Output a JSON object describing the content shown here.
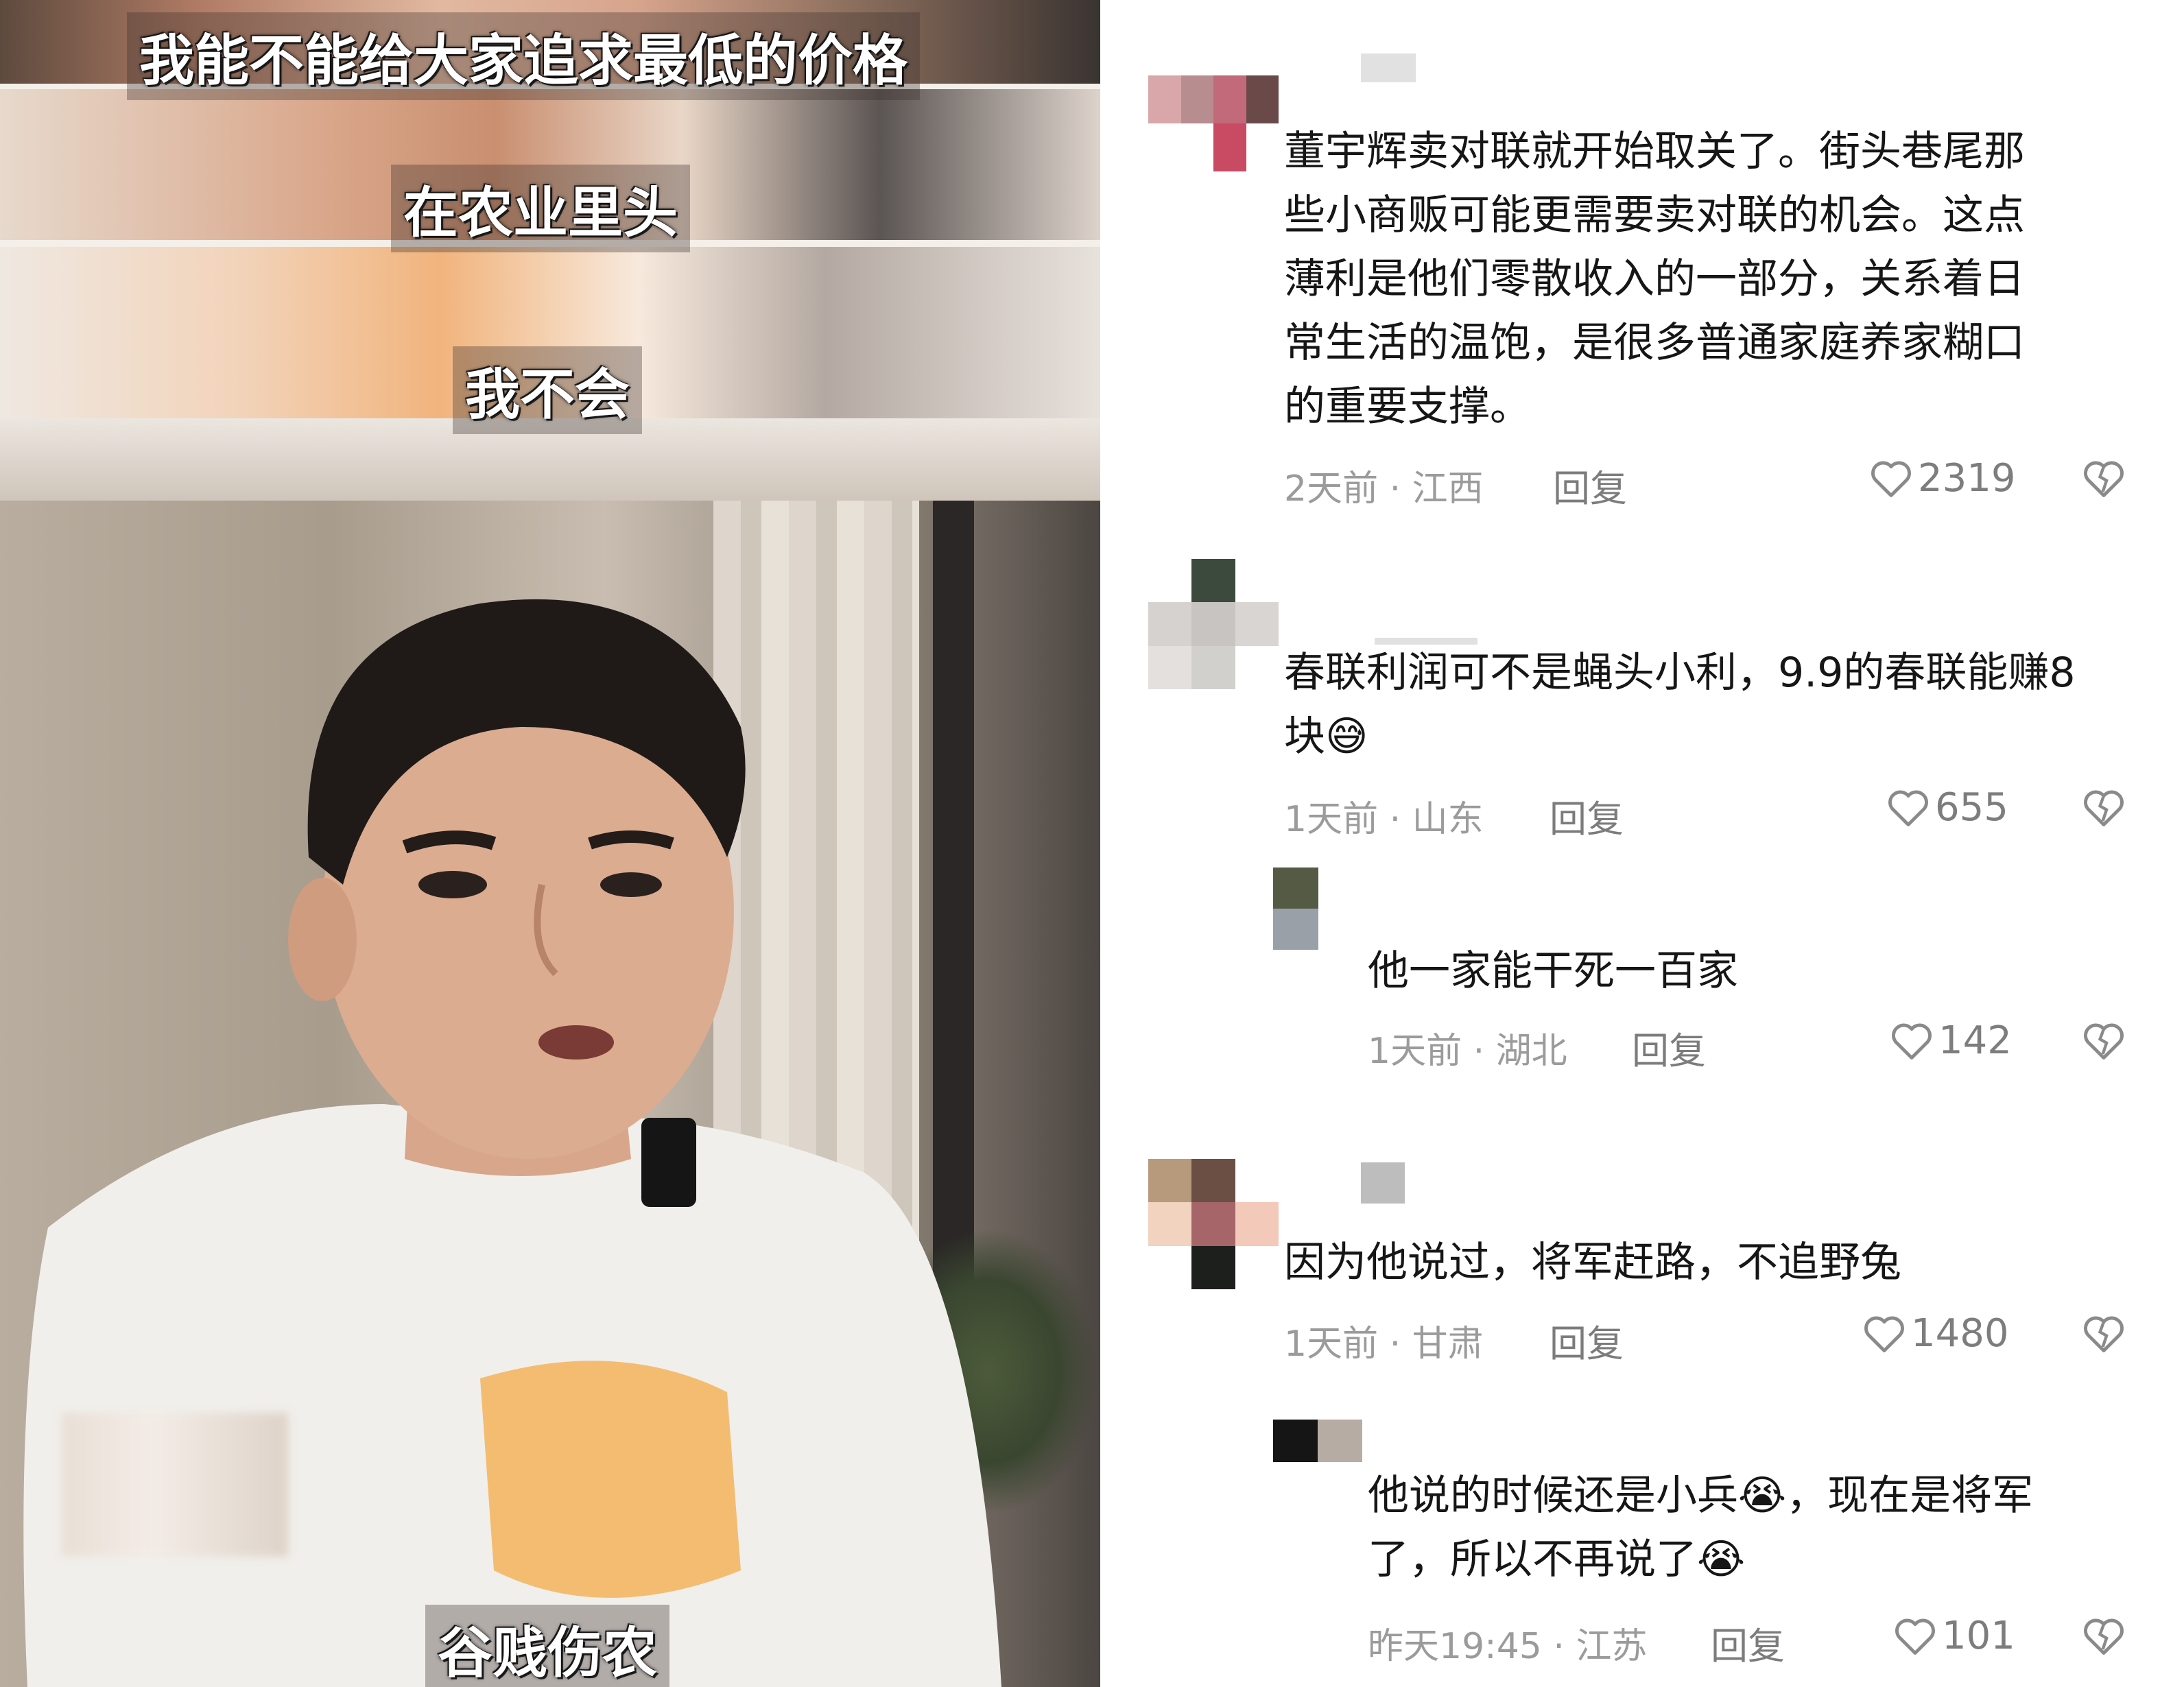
{
  "video": {
    "captions": [
      "我能不能给大家追求最低的价格",
      "在农业里头",
      "我不会",
      "谷贱伤农"
    ]
  },
  "comments": [
    {
      "text": "董宇辉卖对联就开始取关了。街头巷尾那些小商贩可能更需要卖对联的机会。这点薄利是他们零散收入的一部分，关系着日常生活的温饱，是很多普通家庭养家糊口的重要支撑。",
      "lines": [
        "董宇辉卖对联就开始取关了。街头巷尾那",
        "些小商贩可能更需要卖对联的机会。这点",
        "薄利是他们零散收入的一部分，关系着日",
        "常生活的温饱，是很多普通家庭养家糊口",
        "的重要支撑。"
      ],
      "meta": "2天前 · 江西",
      "reply_label": "回复",
      "likes": "2319"
    },
    {
      "lines": [
        "春联利润可不是蝇头小利，9.9的春联能赚8",
        "块😅"
      ],
      "meta": "1天前 · 山东",
      "reply_label": "回复",
      "likes": "655"
    },
    {
      "lines": [
        "他一家能干死一百家"
      ],
      "meta": "1天前 · 湖北",
      "reply_label": "回复",
      "likes": "142"
    },
    {
      "lines": [
        "因为他说过，将军赶路，不追野兔"
      ],
      "meta": "1天前 · 甘肃",
      "reply_label": "回复",
      "likes": "1480"
    },
    {
      "lines": [
        "他说的时候还是小兵😭，现在是将军",
        "了，所以不再说了😭"
      ],
      "meta": "昨天19:45 · 江苏",
      "reply_label": "回复",
      "likes": "101"
    }
  ],
  "icons": {
    "like": "heart-outline-icon",
    "dislike": "broken-heart-icon"
  }
}
